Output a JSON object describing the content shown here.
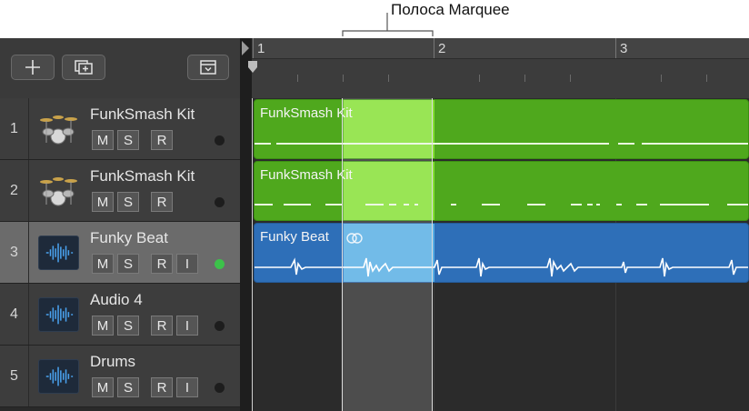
{
  "annotation": {
    "label": "Полоса Marquee"
  },
  "ruler": {
    "bars": [
      "1",
      "2",
      "3"
    ]
  },
  "header": {
    "add_track_icon": "plus-icon",
    "duplicate_track_icon": "duplicate-track-icon",
    "global_tracks_icon": "global-tracks-icon"
  },
  "track_buttons": {
    "mute": "M",
    "solo": "S",
    "record": "R",
    "input": "I"
  },
  "tracks": [
    {
      "number": "1",
      "name": "FunkSmash Kit",
      "icon": "drum-kit-icon",
      "record_active": false
    },
    {
      "number": "2",
      "name": "FunkSmash Kit",
      "icon": "drum-kit-icon",
      "record_active": false
    },
    {
      "number": "3",
      "name": "Funky Beat",
      "icon": "waveform-icon",
      "record_active": true,
      "selected": true
    },
    {
      "number": "4",
      "name": "Audio 4",
      "icon": "waveform-icon",
      "record_active": false
    },
    {
      "number": "5",
      "name": "Drums",
      "icon": "waveform-icon",
      "record_active": false
    }
  ],
  "regions": [
    {
      "track": "1",
      "name": "FunkSmash Kit",
      "type": "midi"
    },
    {
      "track": "2",
      "name": "FunkSmash Kit",
      "type": "midi"
    },
    {
      "track": "3",
      "name": "Funky Beat",
      "type": "audio",
      "looped": true
    }
  ],
  "colors": {
    "midi_region": "#4fa81d",
    "midi_marquee": "#86e035",
    "audio_region": "#2e6fb8",
    "audio_marquee": "#58aee4",
    "record_on": "#3cc24a"
  }
}
